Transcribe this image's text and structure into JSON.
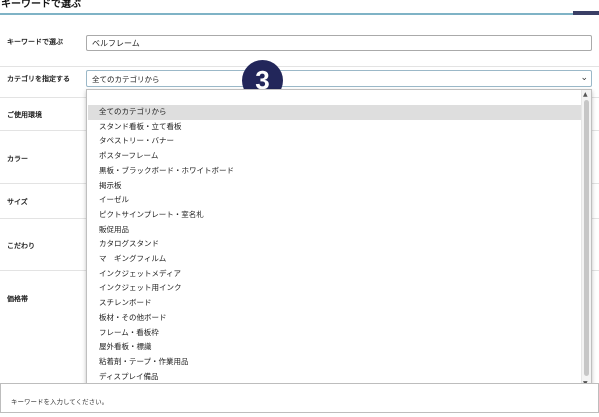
{
  "header": {
    "title": "キーワードで選ぶ"
  },
  "keyword": {
    "label": "キーワードで選ぶ",
    "value": "ベルフレーム"
  },
  "category": {
    "label": "カテゴリを指定する",
    "selected": "全てのカテゴリから",
    "arrow_icon": "chevron-down-icon",
    "options": [
      "全てのカテゴリから",
      "スタンド看板・立て看板",
      "タペストリー・バナー",
      "ポスターフレーム",
      "黒板・ブラックボード・ホワイトボード",
      "掲示板",
      "イーゼル",
      "ピクトサインプレート・室名札",
      "販促用品",
      "カタログスタンド",
      "マ　ギングフィルム",
      "インクジェットメディア",
      "インクジェット用インク",
      "スチレンボード",
      "板材・その他ボード",
      "フレーム・看板枠",
      "屋外看板・標識",
      "粘着剤・テープ・作業用品",
      "ディスプレイ備品"
    ]
  },
  "filters": {
    "environment_label": "ご使用環境",
    "color_label": "カラー",
    "size_label": "サイズ",
    "preference_label": "こだわり",
    "price_label": "価格帯"
  },
  "step_badge": "3",
  "footer": {
    "hint": "キーワードを入力してください。"
  }
}
